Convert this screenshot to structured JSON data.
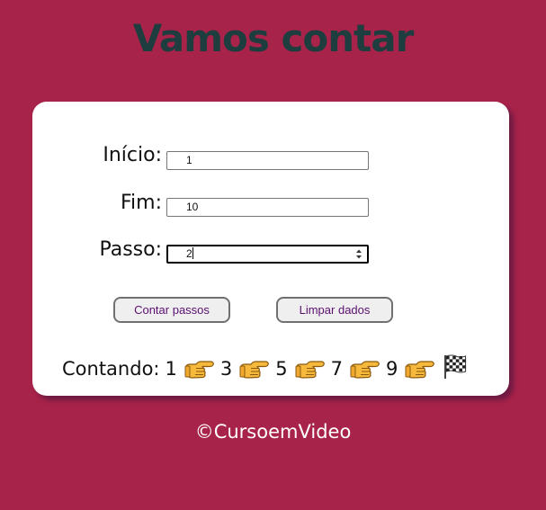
{
  "page": {
    "title": "Vamos contar",
    "footer": "©CursoemVideo"
  },
  "form": {
    "inicio_label": "Início:",
    "inicio_value": "1",
    "fim_label": "Fim:",
    "fim_value": "10",
    "passo_label": "Passo:",
    "passo_value": "2"
  },
  "buttons": {
    "contar_label": "Contar passos",
    "limpar_label": "Limpar dados"
  },
  "result": {
    "prefix": "Contando:",
    "numbers": [
      "1",
      "3",
      "5",
      "7",
      "9"
    ],
    "step_icon": "pointing-hand-icon",
    "end_icon": "checkered-flag-icon"
  },
  "colors": {
    "background": "#a8234a",
    "title": "#1d3d3e",
    "button_text": "#5b1070",
    "card": "#ffffff"
  }
}
